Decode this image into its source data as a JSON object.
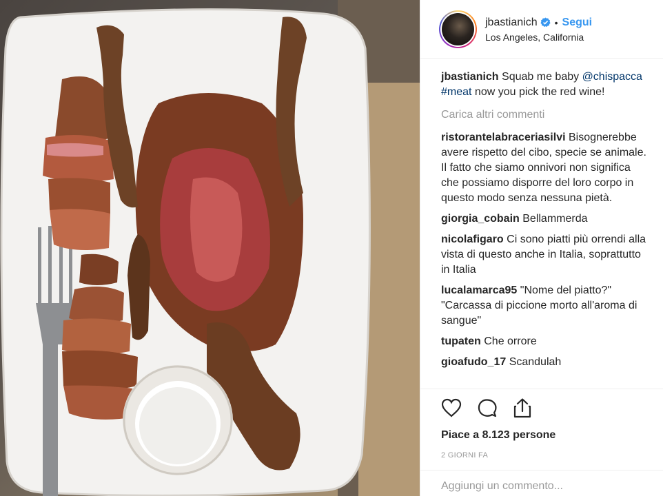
{
  "header": {
    "username": "jbastianich",
    "separator": "•",
    "follow_label": "Segui",
    "location": "Los Angeles, California"
  },
  "caption": {
    "username": "jbastianich",
    "text_before": "Squab me baby",
    "mention": "@chispacca",
    "hashtag": "#meat",
    "text_after": "now you pick the red wine!"
  },
  "load_more_label": "Carica altri commenti",
  "comments": [
    {
      "user": "ristorantelabraceriasilvi",
      "text": "Bisognerebbe avere rispetto del cibo, specie se animale. Il fatto che siamo onnivori non significa che possiamo disporre del loro corpo in questo modo senza nessuna pietà."
    },
    {
      "user": "giorgia_cobain",
      "text": "Bellammerda"
    },
    {
      "user": "nicolafigaro",
      "text": "Ci sono piatti più orrendi alla vista di questo anche in Italia, soprattutto in Italia"
    },
    {
      "user": "lucalamarca95",
      "text": "\"Nome del piatto?\" \"Carcassa di piccione morto all'aroma di sangue\""
    },
    {
      "user": "tupaten",
      "text": "Che orrore"
    },
    {
      "user": "gioafudo_17",
      "text": "Scandulah"
    }
  ],
  "actions": {
    "like_icon": "heart-outline-icon",
    "comment_icon": "comment-bubble-icon",
    "share_icon": "share-upload-icon"
  },
  "likes_text": "Piace a 8.123 persone",
  "timestamp": "2 GIORNI FA",
  "add_comment_placeholder": "Aggiungi un commento...",
  "colors": {
    "link": "#003569",
    "follow": "#3897f0",
    "muted": "#999999",
    "text": "#262626",
    "verified": "#3897f0"
  }
}
